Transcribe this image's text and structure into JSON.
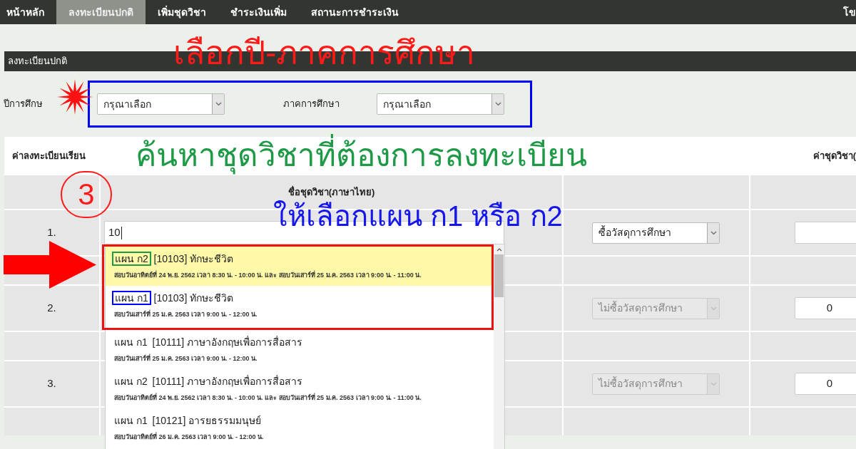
{
  "nav": {
    "items": [
      {
        "label": "หน้าหลัก",
        "selected": false
      },
      {
        "label": "ลงทะเบียนปกติ",
        "selected": true
      },
      {
        "label": "เพิ่มชุดวิชา",
        "selected": false
      },
      {
        "label": "ชำระเงินเพิ่ม",
        "selected": false
      },
      {
        "label": "สถานะการชำระเงิน",
        "selected": false
      }
    ],
    "user_text": "โข"
  },
  "section_title": "ลงทะเบียนปกติ",
  "term": {
    "year_label": "ปีการศึกษ",
    "year_value": "กรุณาเลือก",
    "semester_label": "ภาคการศึกษา",
    "semester_value": "กรุณาเลือก"
  },
  "table": {
    "caption_left": "ค่าลงทะเบียนเรียน",
    "caption_right": "ค่าชุดวิชา(",
    "column_header": "ชื่อชุดวิชา(ภาษาไทย)",
    "rows": [
      {
        "number": "1.",
        "search_value": "10",
        "material": "ซื้อวัสดุการศึกษา",
        "material_disabled": false
      },
      {
        "number": "2.",
        "material": "ไม่ซื้อวัสดุการศึกษา",
        "material_disabled": true,
        "fee": "0"
      },
      {
        "number": "3.",
        "material": "ไม่ซื้อวัสดุการศึกษา",
        "material_disabled": true,
        "fee": "0"
      }
    ]
  },
  "suggestions": [
    {
      "plan": "แผน ก2",
      "code": "[10103]",
      "name": "ทักษะชีวิต",
      "exam": "สอบวันอาทิตย์ที่ 24 พ.ย. 2562 เวลา 8:30 น. - 10:00 น. และ สอบวันเสาร์ที่ 25 ม.ค. 2563 เวลา 9:00 น. - 11:00 น.",
      "selected": true,
      "framed": true,
      "color": "#1e9a46"
    },
    {
      "plan": "แผน ก1",
      "code": "[10103]",
      "name": "ทักษะชีวิต",
      "exam": "สอบวันเสาร์ที่ 25 ม.ค. 2563 เวลา 9:00 น. - 12:00 น.",
      "selected": false,
      "framed": true,
      "color": "#0000ff"
    },
    {
      "plan": "แผน ก1",
      "code": "[10111]",
      "name": "ภาษาอังกฤษเพื่อการสื่อสาร",
      "exam": "สอบวันเสาร์ที่ 25 ม.ค. 2563 เวลา 9:00 น. - 12:00 น.",
      "selected": false,
      "framed": false
    },
    {
      "plan": "แผน ก2",
      "code": "[10111]",
      "name": "ภาษาอังกฤษเพื่อการสื่อสาร",
      "exam": "สอบวันอาทิตย์ที่ 24 พ.ย. 2562 เวลา 8:30 น. - 10:00 น. และ สอบวันเสาร์ที่ 25 ม.ค. 2563 เวลา 9:00 น. - 11:00 น.",
      "selected": false,
      "framed": false
    },
    {
      "plan": "แผน ก1",
      "code": "[10121]",
      "name": "อารยธรรมมนุษย์",
      "exam": "สอบวันอาทิตย์ที่ 26 ม.ค. 2563 เวลา 9:00 น. - 12:00 น.",
      "selected": false,
      "framed": false
    }
  ],
  "annotations": {
    "term_title": "เลือกปี-ภาคการศึกษา",
    "search_title": "ค้นหาชุดวิชาที่ต้องการลงทะเบียน",
    "step_number": "3",
    "plan_hint": "ให้เลือกแผน ก1 หรือ ก2"
  }
}
